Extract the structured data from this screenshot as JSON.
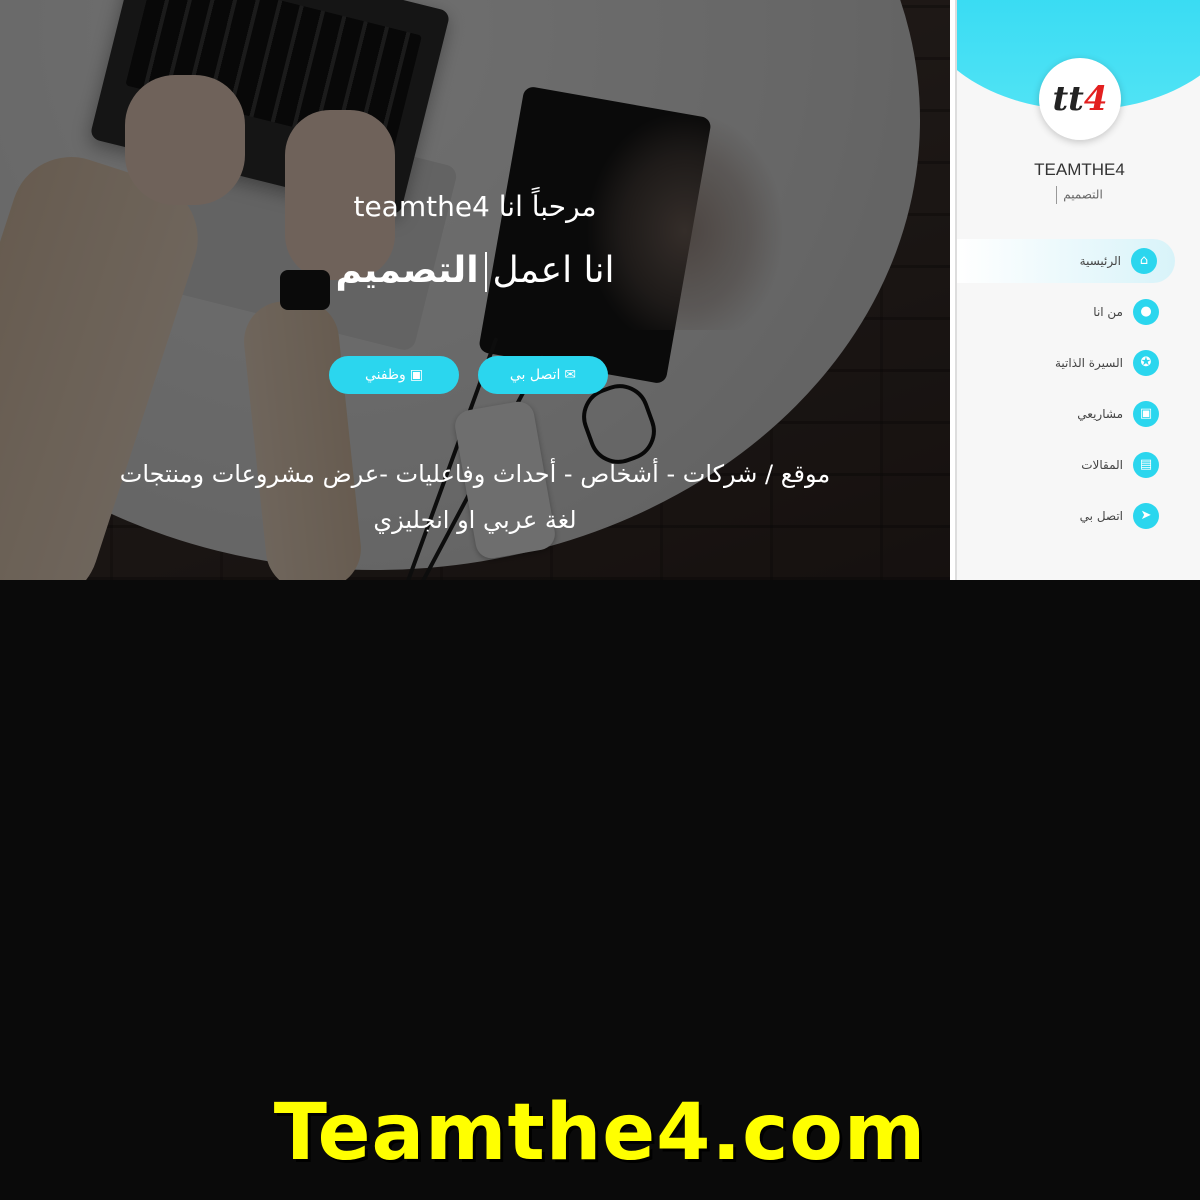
{
  "hero": {
    "greeting": "مرحباً انا teamthe4",
    "headline_prefix": "انا اعمل",
    "headline_word": "التصميم",
    "buttons": {
      "contact_label": "اتصل بي",
      "contact_icon": "envelope-icon",
      "jobs_label": "وظفني",
      "jobs_icon": "briefcase-icon"
    },
    "description_line1": "موقع / شركات - أشخاص - أحداث وفاعليات -عرض مشروعات ومنتجات",
    "description_line2": "لغة عربي او انجليزي"
  },
  "sidebar": {
    "logo_text_main": "tt",
    "logo_text_accent": "4",
    "brand_name": "TEAMTHE4",
    "tagline": "التصميم",
    "items": [
      {
        "label": "الرئيسية",
        "icon": "home-icon",
        "active": true
      },
      {
        "label": "من انا",
        "icon": "user-icon",
        "active": false
      },
      {
        "label": "السيرة الذاتية",
        "icon": "award-icon",
        "active": false
      },
      {
        "label": "مشاريعي",
        "icon": "briefcase-icon",
        "active": false
      },
      {
        "label": "المقالات",
        "icon": "article-icon",
        "active": false
      },
      {
        "label": "اتصل بي",
        "icon": "send-icon",
        "active": false
      }
    ]
  },
  "footer": {
    "wordmark": "Teamthe4.com"
  },
  "colors": {
    "accent": "#2bd6ee",
    "wordmark": "#ffff00",
    "page_bg": "#0a0a0a"
  }
}
